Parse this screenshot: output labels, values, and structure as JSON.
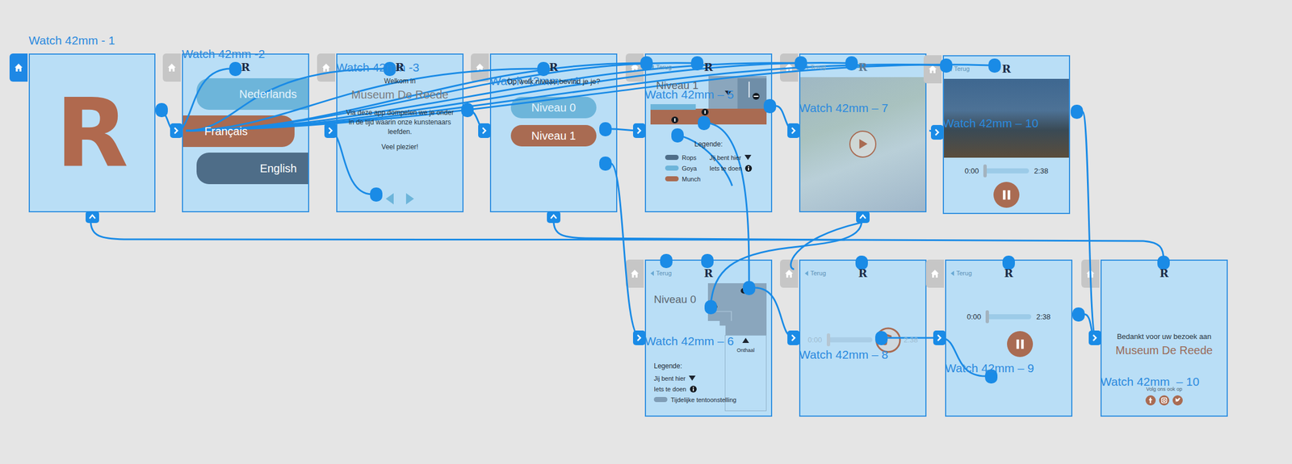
{
  "artboards": [
    {
      "label": "Watch 42mm - 1",
      "kind": "splash",
      "home_selected": true,
      "logo": "R"
    },
    {
      "label": "Watch 42mm -2",
      "kind": "language",
      "home_selected": false,
      "logo": "R",
      "options": [
        {
          "label": "Nederlands",
          "color": "#6db5da"
        },
        {
          "label": "Français",
          "color": "#a96b52"
        },
        {
          "label": "English",
          "color": "#4e6d88"
        }
      ]
    },
    {
      "label": "Watch 42mm -3",
      "kind": "welcome",
      "home_selected": false,
      "logo": "R",
      "greeting": "Welkom in",
      "museum": "Museum De Reede",
      "intro": "Via deze app dompelen we je onder in de tijd waarin onze kunstenaars leefden.",
      "closing": "Veel plezier!"
    },
    {
      "label": "Watch 42mm – 4",
      "kind": "levels",
      "home_selected": false,
      "logo": "R",
      "question": "Op welk niveau bevind je je?",
      "options": [
        {
          "label": "Niveau 0",
          "color": "#6db5da"
        },
        {
          "label": "Niveau 1",
          "color": "#a96b52"
        }
      ]
    },
    {
      "label": "Watch 42mm – 5",
      "kind": "map",
      "home_selected": false,
      "back": "Terug",
      "logo": "R",
      "title": "Niveau 1",
      "legend_title": "Legende:",
      "legend": [
        {
          "label": "Rops",
          "kind": "swatch",
          "color": "#4e6d88"
        },
        {
          "label": "Goya",
          "kind": "swatch",
          "color": "#6db5da"
        },
        {
          "label": "Munch",
          "kind": "swatch",
          "color": "#a96b52"
        },
        {
          "label": "Jij bent hier",
          "kind": "marker"
        },
        {
          "label": "Iets te doen",
          "kind": "info"
        }
      ],
      "map_labels": []
    },
    {
      "label": "Watch 42mm – 7",
      "kind": "video",
      "home_selected": false,
      "back": "Terug",
      "logo": "R",
      "playing": false
    },
    {
      "label": "Watch 42mm – 10",
      "kind": "painting_player",
      "home_selected": false,
      "back": "Terug",
      "logo": "R",
      "time_start": "0:00",
      "time_end": "2:38",
      "level": 0.03,
      "playing": true
    },
    {
      "label": "Watch 42mm – 6",
      "kind": "map",
      "home_selected": false,
      "back": "Terug",
      "logo": "R",
      "title": "Niveau 0",
      "legend_title": "Legende:",
      "legend": [
        {
          "label": "Jij bent hier",
          "kind": "marker"
        },
        {
          "label": "Iets te doen",
          "kind": "info"
        },
        {
          "label": "Tijdelijke tentoonstelling",
          "kind": "swatch",
          "color": "#7f9db6"
        }
      ],
      "map_labels": [
        "Onthaal"
      ]
    },
    {
      "label": "Watch 42mm – 8",
      "kind": "audio_idle",
      "home_selected": false,
      "back": "Terug",
      "logo": "R",
      "time_start": "0:00",
      "time_end": "2:38",
      "level": 0.03
    },
    {
      "label": "Watch 42mm – 9",
      "kind": "audio_player",
      "home_selected": false,
      "back": "Terug",
      "logo": "R",
      "time_start": "0:00",
      "time_end": "2:38",
      "level": 0.03,
      "playing": true
    },
    {
      "label": "Watch 42mm  – 10",
      "kind": "thanks",
      "home_selected": false,
      "logo": "R",
      "thanks": "Bedankt voor uw bezoek aan",
      "museum": "Museum De Reede",
      "follow": "Volg ons ook op"
    }
  ]
}
